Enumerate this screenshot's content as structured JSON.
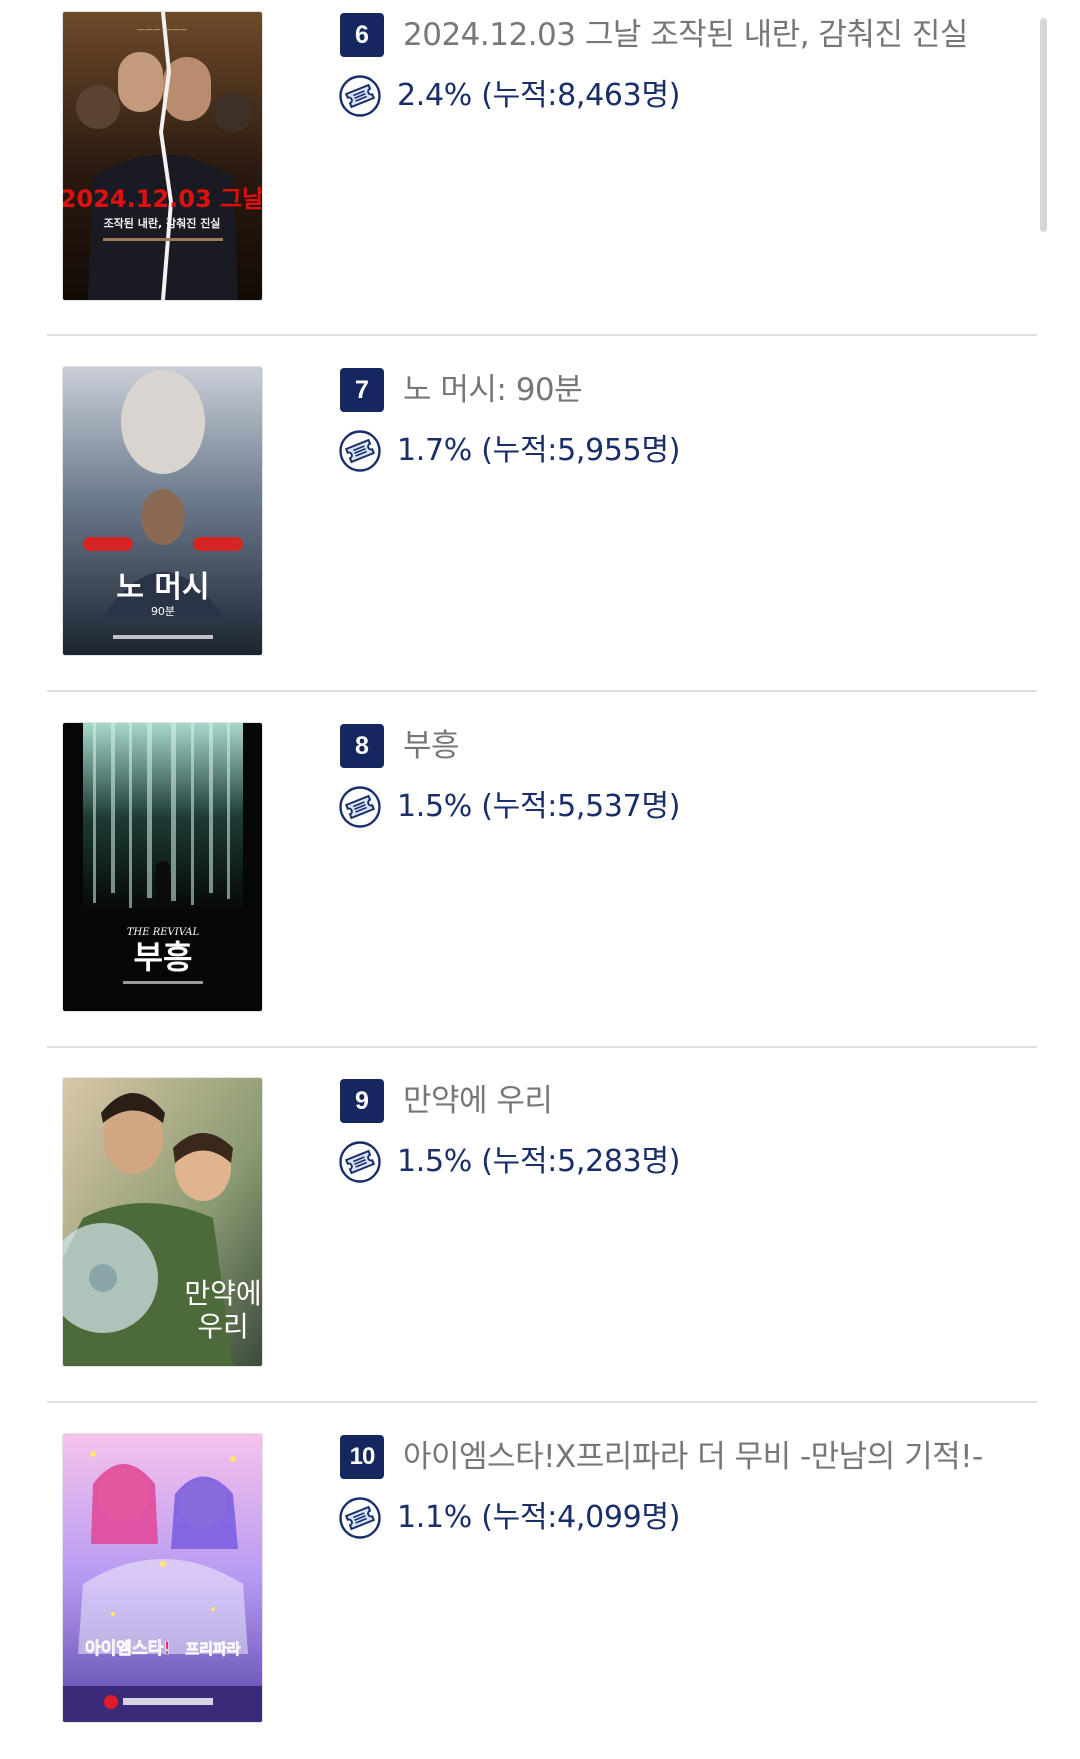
{
  "movies": [
    {
      "rank": "6",
      "title": "2024.12.03 그날 조작된 내란, 감춰진 진실",
      "share": "2.4% (누적:8,463명)"
    },
    {
      "rank": "7",
      "title": "노 머시: 90분",
      "share": "1.7% (누적:5,955명)"
    },
    {
      "rank": "8",
      "title": "부흥",
      "share": "1.5% (누적:5,537명)"
    },
    {
      "rank": "9",
      "title": "만약에 우리",
      "share": "1.5% (누적:5,283명)"
    },
    {
      "rank": "10",
      "title": "아이엠스타!X프리파라 더 무비 -만남의 기적!-",
      "share": "1.1% (누적:4,099명)"
    }
  ],
  "posters": {
    "p6": {
      "headline": "2024.12.03 그날",
      "subline": "조작된 내란, 감춰진 진실"
    },
    "p7": {
      "headline": "노 머시",
      "subline": "90분"
    },
    "p8": {
      "headline": "부흥",
      "subline": "THE REVIVAL"
    },
    "p9": {
      "headline": "만약에",
      "subline": "우리"
    },
    "p10": {
      "headline": "아이엠스타!",
      "subline": "프리파라"
    }
  },
  "icons": {
    "ticket": "ticket-icon"
  },
  "colors": {
    "badge": "#14285f",
    "share_text": "#1a2e6a",
    "title_text": "#777777"
  }
}
